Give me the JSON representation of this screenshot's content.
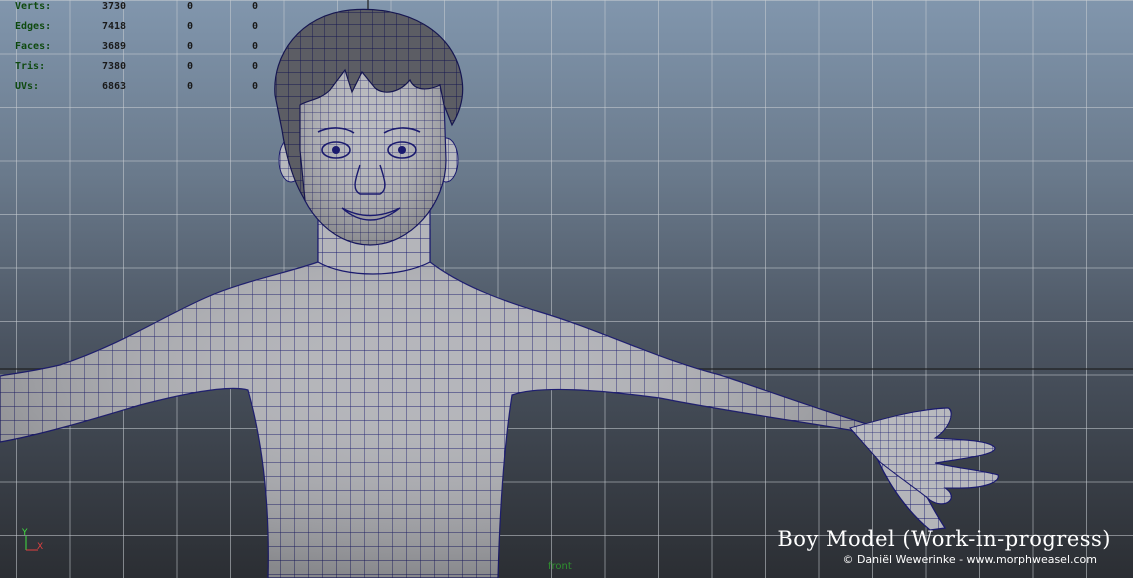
{
  "stats": [
    {
      "label": "Verts:",
      "v1": "3730",
      "v2": "0",
      "v3": "0"
    },
    {
      "label": "Edges:",
      "v1": "7418",
      "v2": "0",
      "v3": "0"
    },
    {
      "label": "Faces:",
      "v1": "3689",
      "v2": "0",
      "v3": "0"
    },
    {
      "label": "Tris:",
      "v1": "7380",
      "v2": "0",
      "v3": "0"
    },
    {
      "label": "UVs:",
      "v1": "6863",
      "v2": "0",
      "v3": "0"
    }
  ],
  "axis": {
    "y": "Y",
    "x": "X"
  },
  "camera_label": "front",
  "title": "Boy Model (Work-in-progress)",
  "credit": "© Daniël Wewerinke - www.morphweasel.com",
  "colors": {
    "wire": "#1a1a6e",
    "skin": "#b8b8bc",
    "hair": "#5a5a60",
    "grid": "#c8cdd2"
  }
}
